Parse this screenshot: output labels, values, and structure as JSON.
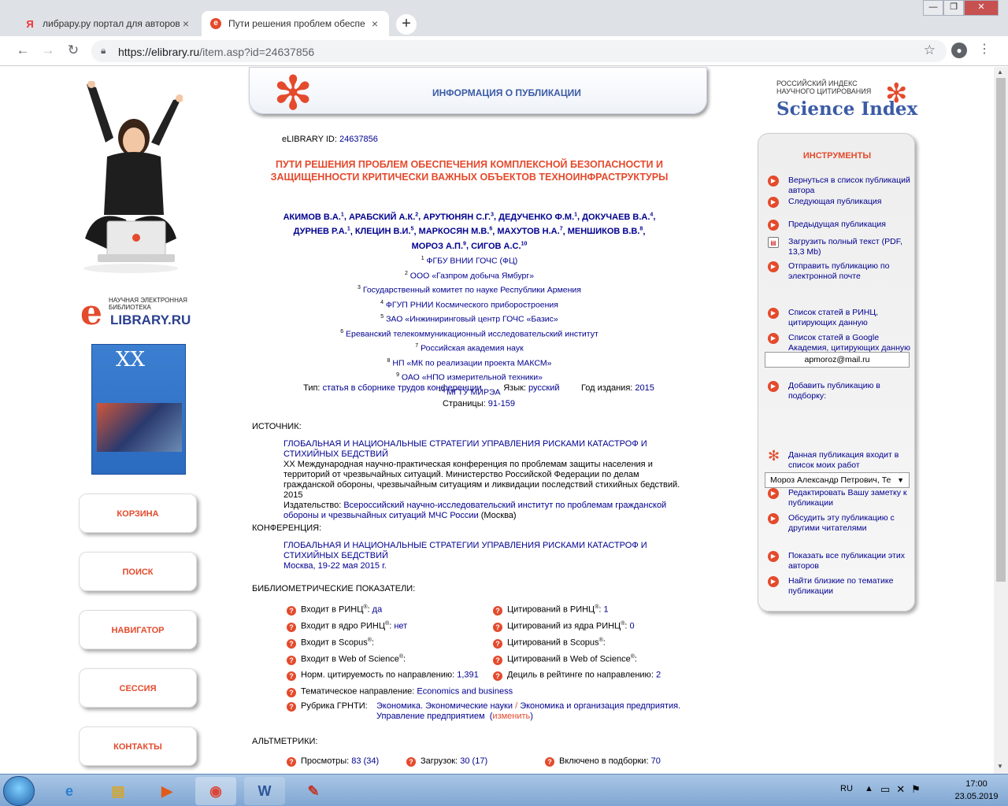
{
  "browser": {
    "tabs": [
      {
        "label": "либрару.ру портал для авторов",
        "icon": "yandex-icon",
        "close": "×"
      },
      {
        "label": "Пути решения проблем обеспе",
        "icon": "elibrary-icon",
        "close": "×"
      }
    ],
    "new_tab": "+",
    "url_host": "https://elibrary.ru",
    "url_path": "/item.asp?id=24637856",
    "window_controls": [
      "—",
      "❐",
      "✕"
    ]
  },
  "left": {
    "lib_small": "НАУЧНАЯ ЭЛЕКТРОННАЯ БИБЛИОТЕКА",
    "lib_letter": "e",
    "lib_big": "LIBRARY.RU",
    "book_numeral": "XX",
    "buttons": [
      "КОРЗИНА",
      "ПОИСК",
      "НАВИГАТОР",
      "СЕССИЯ",
      "КОНТАКТЫ"
    ]
  },
  "banner": {
    "title": "ИНФОРМАЦИЯ О ПУБЛИКАЦИИ"
  },
  "publication": {
    "id_label": "eLIBRARY ID:",
    "id": "24637856",
    "title": "ПУТИ РЕШЕНИЯ ПРОБЛЕМ ОБЕСПЕЧЕНИЯ КОМПЛЕКСНОЙ БЕЗОПАСНОСТИ И ЗАЩИЩЕННОСТИ КРИТИЧЕСКИ ВАЖНЫХ ОБЪЕКТОВ ТЕХНОИНФРАСТРУКТУРЫ",
    "authors": [
      {
        "name": "АКИМОВ В.А.",
        "sup": "1"
      },
      {
        "name": "АРАБСКИЙ А.К.",
        "sup": "2"
      },
      {
        "name": "АРУТЮНЯН С.Г.",
        "sup": "3"
      },
      {
        "name": "ДЕДУЧЕНКО Ф.М.",
        "sup": "1"
      },
      {
        "name": "ДОКУЧАЕВ В.А.",
        "sup": "4"
      },
      {
        "name": "ДУРНЕВ Р.А.",
        "sup": "1"
      },
      {
        "name": "КЛЕЦИН В.И.",
        "sup": "5"
      },
      {
        "name": "МАРКОСЯН М.В.",
        "sup": "6"
      },
      {
        "name": "МАХУТОВ Н.А.",
        "sup": "7"
      },
      {
        "name": "МЕНШИКОВ В.В.",
        "sup": "8"
      },
      {
        "name": "МОРОЗ А.П.",
        "sup": "9"
      },
      {
        "name": "СИГОВ А.С.",
        "sup": "10"
      }
    ],
    "affiliations": [
      {
        "n": "1",
        "name": "ФГБУ ВНИИ ГОЧС (ФЦ)"
      },
      {
        "n": "2",
        "name": "ООО «Газпром добыча Ямбург»"
      },
      {
        "n": "3",
        "name": "Государственный комитет по науке Республики Армения"
      },
      {
        "n": "4",
        "name": "ФГУП РНИИ Космического приборостроения"
      },
      {
        "n": "5",
        "name": "ЗАО «Инжиниринговый центр ГОЧС «Базис»"
      },
      {
        "n": "6",
        "name": "Ереванский телекоммуникационный исследовательский институт"
      },
      {
        "n": "7",
        "name": "Российская академия наук"
      },
      {
        "n": "8",
        "name": "НП «МК по реализации проекта МАКСМ»"
      },
      {
        "n": "9",
        "name": "ОАО «НПО измерительной техники»"
      },
      {
        "n": "10",
        "name": "МГТУ МИРЭА"
      }
    ],
    "type_label": "Тип:",
    "type": "статья в сборнике трудов конференции",
    "lang_label": "Язык:",
    "lang": "русский",
    "year_label": "Год издания:",
    "year": "2015",
    "pages_label": "Страницы:",
    "pages": "91-159"
  },
  "source": {
    "head": "ИСТОЧНИК:",
    "title": "ГЛОБАЛЬНАЯ И НАЦИОНАЛЬНЫЕ СТРАТЕГИИ УПРАВЛЕНИЯ РИСКАМИ КАТАСТРОФ И СТИХИЙНЫХ БЕДСТВИЙ",
    "desc": "XX Международная научно-практическая конференция по проблемам защиты населения и территорий от чрезвычайных ситуаций. Министерство Российской Федерации по делам гражданской обороны, чрезвычайным ситуациям и ликвидации последствий стихийных бедствий. 2015",
    "publisher_label": "Издательство:",
    "publisher": "Всероссийский научно-исследовательский институт по проблемам гражданской обороны и чрезвычайных ситуаций МЧС России",
    "publisher_city": "(Москва)"
  },
  "conference": {
    "head": "КОНФЕРЕНЦИЯ:",
    "title": "ГЛОБАЛЬНАЯ И НАЦИОНАЛЬНЫЕ СТРАТЕГИИ УПРАВЛЕНИЯ РИСКАМИ КАТАСТРОФ И СТИХИЙНЫХ БЕДСТВИЙ",
    "place": "Москва, 19-22 мая 2015 г."
  },
  "biblio": {
    "head": "БИБЛИОМЕТРИЧЕСКИЕ ПОКАЗАТЕЛИ:",
    "left": [
      {
        "label": "Входит в РИНЦ",
        "reg": "®",
        "sep": ":",
        "value": "да"
      },
      {
        "label": "Входит в ядро РИНЦ",
        "reg": "®",
        "sep": ":",
        "value": "нет"
      },
      {
        "label": "Входит в Scopus",
        "reg": "®",
        "sep": ":",
        "value": ""
      },
      {
        "label": "Входит в Web of Science",
        "reg": "®",
        "sep": ":",
        "value": ""
      },
      {
        "label": "Норм. цитируемость по направлению",
        "reg": "",
        "sep": ":",
        "value": "1,391"
      },
      {
        "label": "Тематическое направление",
        "reg": "",
        "sep": ":",
        "value": "Economics and business"
      }
    ],
    "right": [
      {
        "label": "Цитирований в РИНЦ",
        "reg": "®",
        "sep": ":",
        "value": "1"
      },
      {
        "label": "Цитирований из ядра РИНЦ",
        "reg": "®",
        "sep": ":",
        "value": "0"
      },
      {
        "label": "Цитирований в Scopus",
        "reg": "®",
        "sep": ":",
        "value": ""
      },
      {
        "label": "Цитирований в Web of Science",
        "reg": "®",
        "sep": ":",
        "value": ""
      },
      {
        "label": "Дециль в рейтинге по направлению",
        "reg": "",
        "sep": ":",
        "value": "2"
      }
    ],
    "grnti_label": "Рубрика ГРНТИ:",
    "grnti_1": "Экономика. Экономические науки",
    "grnti_sep": "/",
    "grnti_2": "Экономика и организация предприятия. Управление предприятием",
    "grnti_change_open": "(",
    "grnti_change": "изменить",
    "grnti_change_close": ")"
  },
  "altmetrics": {
    "head": "АЛЬТМЕТРИКИ:",
    "items": [
      {
        "label": "Просмотры",
        "value": "83 (34)"
      },
      {
        "label": "Загрузок",
        "value": "30 (17)"
      },
      {
        "label": "Включено в подборки",
        "value": "70"
      }
    ]
  },
  "right": {
    "si_l1": "РОССИЙСКИЙ ИНДЕКС НАУЧНОГО ЦИТИРОВАНИЯ",
    "si_l2": "Science Index",
    "tools_head": "ИНСТРУМЕНТЫ",
    "items": [
      "Вернуться в список публикаций автора",
      "Следующая публикация",
      "Предыдущая публикация",
      "Загрузить полный текст (PDF, 13,3 Mb)",
      "Отправить публикацию по электронной почте",
      "Список статей в РИНЦ, цитирующих данную",
      "Список статей в Google Академия, цитирующих данную",
      "Добавить публикацию в подборку:",
      "Данная публикация входит в список моих работ",
      "Редактировать Вашу заметку к публикации",
      "Обсудить эту публикацию с другими читателями",
      "Показать все публикации этих авторов",
      "Найти близкие по тематике публикации"
    ],
    "email": "apmoroz@mail.ru",
    "select_value": "Мороз Александр Петрович, Те"
  },
  "taskbar": {
    "lang": "RU",
    "time": "17:00",
    "date": "23.05.2019"
  },
  "colors": {
    "accent": "#e44a2c",
    "link": "#00008f",
    "brand_blue": "#3b5ba5"
  }
}
